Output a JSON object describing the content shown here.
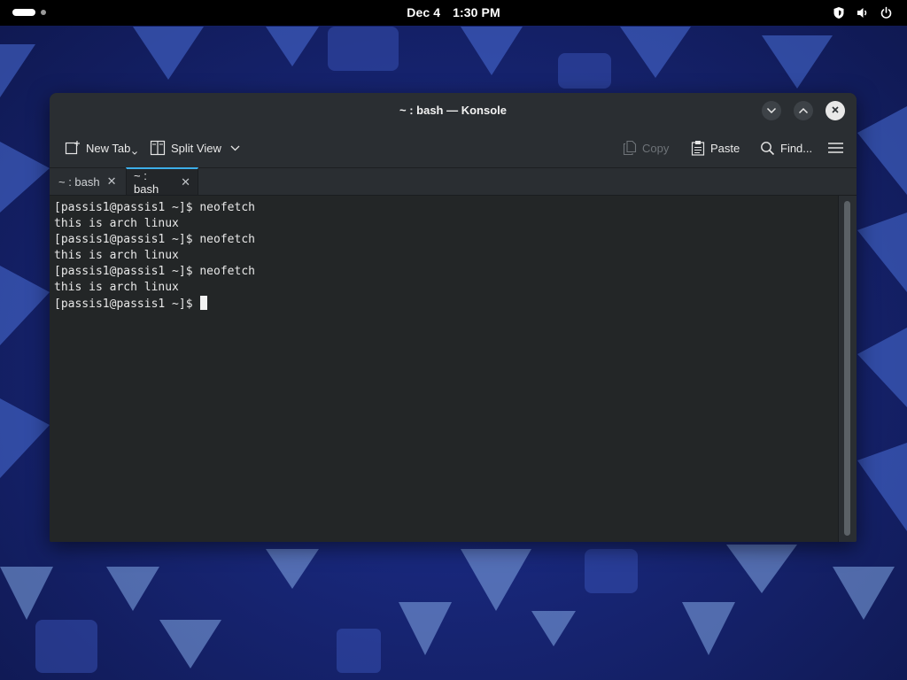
{
  "topbar": {
    "date": "Dec 4",
    "time": "1:30 PM",
    "icons": [
      "shield-icon",
      "volume-icon",
      "power-icon"
    ]
  },
  "window": {
    "title": "~ : bash — Konsole",
    "controls": [
      "minimize-chevron-icon",
      "maximize-chevron-icon",
      "close-icon"
    ]
  },
  "toolbar": {
    "new_tab_label": "New Tab",
    "split_view_label": "Split View",
    "copy_label": "Copy",
    "paste_label": "Paste",
    "find_label": "Find...",
    "menu_icon": "hamburger-icon"
  },
  "tabs": [
    {
      "label": "~ : bash",
      "active": false
    },
    {
      "label": "~ : bash",
      "active": true
    }
  ],
  "terminal": {
    "lines": [
      "[passis1@passis1 ~]$ neofetch",
      "this is arch linux",
      "[passis1@passis1 ~]$ neofetch",
      "this is arch linux",
      "[passis1@passis1 ~]$ neofetch",
      "this is arch linux"
    ],
    "prompt": "[passis1@passis1 ~]$ "
  },
  "colors": {
    "accent": "#3daee9",
    "window_bg": "#232629",
    "titlebar_bg": "#2a2e32",
    "topbar_bg": "#000000"
  }
}
